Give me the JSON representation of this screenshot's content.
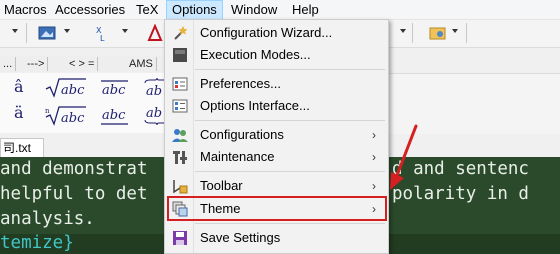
{
  "menubar": {
    "items": [
      {
        "label": "Macros"
      },
      {
        "label": "Accessories"
      },
      {
        "label": "TeX"
      },
      {
        "label": "Options"
      },
      {
        "label": "Window"
      },
      {
        "label": "Help"
      }
    ],
    "active_index": 3
  },
  "math_tabs": [
    "...",
    "--->",
    "< > =",
    "AMS"
  ],
  "file_tab": {
    "label": "司.txt"
  },
  "editor": {
    "lines": [
      "and demonstrat",
      "helpful to det",
      "analysis.",
      "temize}"
    ],
    "lines_right": [
      "d and sentenc",
      "polarity in d"
    ]
  },
  "options_menu": {
    "items": [
      {
        "label": "Configuration Wizard...",
        "icon": "wand-icon",
        "has_submenu": false
      },
      {
        "label": "Execution Modes...",
        "icon": "execution-modes-icon",
        "has_submenu": false
      },
      {
        "label": "Preferences...",
        "icon": "preferences-icon",
        "has_submenu": false
      },
      {
        "label": "Options Interface...",
        "icon": "options-interface-icon",
        "has_submenu": false
      },
      {
        "label": "Configurations",
        "icon": "configurations-icon",
        "has_submenu": true
      },
      {
        "label": "Maintenance",
        "icon": "maintenance-icon",
        "has_submenu": true
      },
      {
        "label": "Toolbar",
        "icon": "toolbar-icon",
        "has_submenu": true
      },
      {
        "label": "Theme",
        "icon": "theme-icon",
        "has_submenu": true
      },
      {
        "label": "Save Settings",
        "icon": "save-icon",
        "has_submenu": false
      }
    ],
    "submenu_arrow": "›"
  },
  "colors": {
    "highlight_box": "#d42020",
    "annotation_arrow": "#d42020",
    "editor_bg": "#2b4a2b",
    "menu_active_bg": "#cce8ff"
  }
}
